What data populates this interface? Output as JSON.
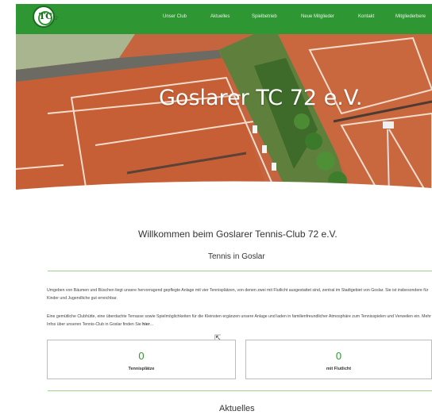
{
  "nav": {
    "logo_text": "TC",
    "logo_number": "72",
    "items": [
      "Unser Club",
      "Aktuelles",
      "Spielbetrieb",
      "Neue Mitglieder",
      "Kontakt",
      "Mitgliederbere"
    ]
  },
  "hero": {
    "title": "Goslarer TC 72 e.V."
  },
  "welcome": "Willkommen beim Goslarer Tennis-Club 72 e.V.",
  "subtitle": "Tennis in Goslar",
  "paragraphs": {
    "p1": "Umgeben von Bäumen und Büschen liegt unsere hervorragend gepflegte Anlage mit vier Tennisplätzen, von denen zwei mit Flutlicht ausgestattet sind, zentral im Stadtgebiet von Goslar. Sie ist insbesondere für Kinder und Jugendliche gut erreichbar.",
    "p2_text": "Eine gemütliche Clubhütte, eine überdachte Terrasse sowie Spielmöglichkeiten für die Kleinsten ergänzen unsere Anlage und laden in familienfreundlicher Atmosphäre zum Tennisspielen und Verweilen ein. Mehr Infos über unseren Tennis-Club in Goslar finden Sie ",
    "p2_link": "hier",
    "p2_end": "..."
  },
  "stats": [
    {
      "value": "0",
      "label": "Tennisplätze"
    },
    {
      "value": "0",
      "label": "mit Flutlicht"
    }
  ],
  "news_heading": "Aktuelles",
  "colors": {
    "brand_green": "#2e9632",
    "clay": "#c2613b"
  }
}
